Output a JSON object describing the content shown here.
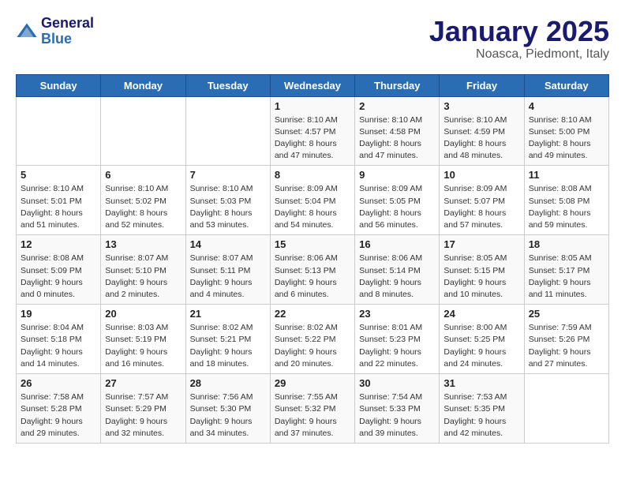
{
  "header": {
    "logo_line1": "General",
    "logo_line2": "Blue",
    "title": "January 2025",
    "subtitle": "Noasca, Piedmont, Italy"
  },
  "weekdays": [
    "Sunday",
    "Monday",
    "Tuesday",
    "Wednesday",
    "Thursday",
    "Friday",
    "Saturday"
  ],
  "weeks": [
    [
      {
        "day": "",
        "info": ""
      },
      {
        "day": "",
        "info": ""
      },
      {
        "day": "",
        "info": ""
      },
      {
        "day": "1",
        "info": "Sunrise: 8:10 AM\nSunset: 4:57 PM\nDaylight: 8 hours\nand 47 minutes."
      },
      {
        "day": "2",
        "info": "Sunrise: 8:10 AM\nSunset: 4:58 PM\nDaylight: 8 hours\nand 47 minutes."
      },
      {
        "day": "3",
        "info": "Sunrise: 8:10 AM\nSunset: 4:59 PM\nDaylight: 8 hours\nand 48 minutes."
      },
      {
        "day": "4",
        "info": "Sunrise: 8:10 AM\nSunset: 5:00 PM\nDaylight: 8 hours\nand 49 minutes."
      }
    ],
    [
      {
        "day": "5",
        "info": "Sunrise: 8:10 AM\nSunset: 5:01 PM\nDaylight: 8 hours\nand 51 minutes."
      },
      {
        "day": "6",
        "info": "Sunrise: 8:10 AM\nSunset: 5:02 PM\nDaylight: 8 hours\nand 52 minutes."
      },
      {
        "day": "7",
        "info": "Sunrise: 8:10 AM\nSunset: 5:03 PM\nDaylight: 8 hours\nand 53 minutes."
      },
      {
        "day": "8",
        "info": "Sunrise: 8:09 AM\nSunset: 5:04 PM\nDaylight: 8 hours\nand 54 minutes."
      },
      {
        "day": "9",
        "info": "Sunrise: 8:09 AM\nSunset: 5:05 PM\nDaylight: 8 hours\nand 56 minutes."
      },
      {
        "day": "10",
        "info": "Sunrise: 8:09 AM\nSunset: 5:07 PM\nDaylight: 8 hours\nand 57 minutes."
      },
      {
        "day": "11",
        "info": "Sunrise: 8:08 AM\nSunset: 5:08 PM\nDaylight: 8 hours\nand 59 minutes."
      }
    ],
    [
      {
        "day": "12",
        "info": "Sunrise: 8:08 AM\nSunset: 5:09 PM\nDaylight: 9 hours\nand 0 minutes."
      },
      {
        "day": "13",
        "info": "Sunrise: 8:07 AM\nSunset: 5:10 PM\nDaylight: 9 hours\nand 2 minutes."
      },
      {
        "day": "14",
        "info": "Sunrise: 8:07 AM\nSunset: 5:11 PM\nDaylight: 9 hours\nand 4 minutes."
      },
      {
        "day": "15",
        "info": "Sunrise: 8:06 AM\nSunset: 5:13 PM\nDaylight: 9 hours\nand 6 minutes."
      },
      {
        "day": "16",
        "info": "Sunrise: 8:06 AM\nSunset: 5:14 PM\nDaylight: 9 hours\nand 8 minutes."
      },
      {
        "day": "17",
        "info": "Sunrise: 8:05 AM\nSunset: 5:15 PM\nDaylight: 9 hours\nand 10 minutes."
      },
      {
        "day": "18",
        "info": "Sunrise: 8:05 AM\nSunset: 5:17 PM\nDaylight: 9 hours\nand 11 minutes."
      }
    ],
    [
      {
        "day": "19",
        "info": "Sunrise: 8:04 AM\nSunset: 5:18 PM\nDaylight: 9 hours\nand 14 minutes."
      },
      {
        "day": "20",
        "info": "Sunrise: 8:03 AM\nSunset: 5:19 PM\nDaylight: 9 hours\nand 16 minutes."
      },
      {
        "day": "21",
        "info": "Sunrise: 8:02 AM\nSunset: 5:21 PM\nDaylight: 9 hours\nand 18 minutes."
      },
      {
        "day": "22",
        "info": "Sunrise: 8:02 AM\nSunset: 5:22 PM\nDaylight: 9 hours\nand 20 minutes."
      },
      {
        "day": "23",
        "info": "Sunrise: 8:01 AM\nSunset: 5:23 PM\nDaylight: 9 hours\nand 22 minutes."
      },
      {
        "day": "24",
        "info": "Sunrise: 8:00 AM\nSunset: 5:25 PM\nDaylight: 9 hours\nand 24 minutes."
      },
      {
        "day": "25",
        "info": "Sunrise: 7:59 AM\nSunset: 5:26 PM\nDaylight: 9 hours\nand 27 minutes."
      }
    ],
    [
      {
        "day": "26",
        "info": "Sunrise: 7:58 AM\nSunset: 5:28 PM\nDaylight: 9 hours\nand 29 minutes."
      },
      {
        "day": "27",
        "info": "Sunrise: 7:57 AM\nSunset: 5:29 PM\nDaylight: 9 hours\nand 32 minutes."
      },
      {
        "day": "28",
        "info": "Sunrise: 7:56 AM\nSunset: 5:30 PM\nDaylight: 9 hours\nand 34 minutes."
      },
      {
        "day": "29",
        "info": "Sunrise: 7:55 AM\nSunset: 5:32 PM\nDaylight: 9 hours\nand 37 minutes."
      },
      {
        "day": "30",
        "info": "Sunrise: 7:54 AM\nSunset: 5:33 PM\nDaylight: 9 hours\nand 39 minutes."
      },
      {
        "day": "31",
        "info": "Sunrise: 7:53 AM\nSunset: 5:35 PM\nDaylight: 9 hours\nand 42 minutes."
      },
      {
        "day": "",
        "info": ""
      }
    ]
  ]
}
